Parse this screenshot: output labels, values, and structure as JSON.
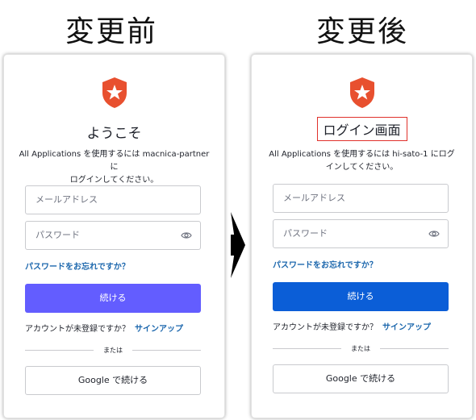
{
  "headings": {
    "before": "変更前",
    "after": "変更後"
  },
  "before": {
    "title": "ようこそ",
    "desc_line1": "All Applications を使用するには macnica-partner に",
    "desc_line2": "ログインしてください。",
    "email_placeholder": "メールアドレス",
    "password_placeholder": "パスワード",
    "forgot_link": "パスワードをお忘れですか？",
    "continue_button": "続ける",
    "no_account_text": "アカウントが未登録ですか？",
    "signup_link": "サインアップ",
    "divider_text": "または",
    "google_button": "Google で続ける",
    "button_color": "#635dff"
  },
  "after": {
    "title": "ログイン画面",
    "desc_line1": "All Applications を使用するには hi-sato-1 にログ",
    "desc_line2": "インしてください。",
    "email_placeholder": "メールアドレス",
    "password_placeholder": "パスワード",
    "forgot_link": "パスワードをお忘れですか？",
    "continue_button": "続ける",
    "no_account_text": "アカウントが未登録ですか？",
    "signup_link": "サインアップ",
    "divider_text": "または",
    "google_button": "Google で続ける",
    "button_color": "#0b5ed7",
    "title_highlight_color": "#e0312b"
  },
  "icons": {
    "logo": "auth0-shield-star-icon",
    "eye": "eye-icon",
    "arrow": "right-arrow-icon"
  },
  "colors": {
    "logo": "#e8502f",
    "link": "#1c67ad"
  }
}
